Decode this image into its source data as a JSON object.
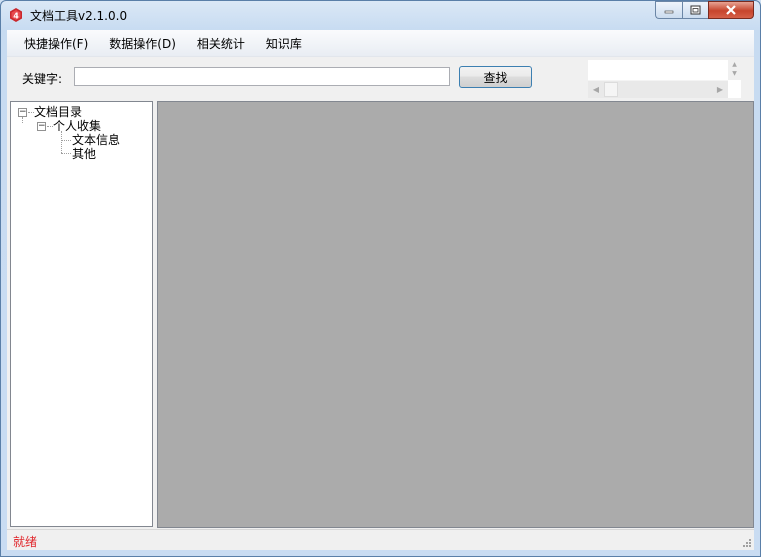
{
  "window": {
    "title": "文档工具v2.1.0.0",
    "app_icon": "app-logo-icon",
    "buttons": [
      "minimize-icon",
      "maximize-icon",
      "close-icon"
    ]
  },
  "menu": {
    "items": [
      {
        "label": "快捷操作(F)"
      },
      {
        "label": "数据操作(D)"
      },
      {
        "label": "相关统计"
      },
      {
        "label": "知识库"
      }
    ]
  },
  "search": {
    "label": "关键字:",
    "value": "",
    "button_label": "查找"
  },
  "tree": {
    "root": {
      "label": "文档目录",
      "expanded": true
    },
    "group": {
      "label": "个人收集",
      "expanded": true
    },
    "children": [
      {
        "label": "文本信息"
      },
      {
        "label": "其他"
      }
    ]
  },
  "status": {
    "text": "就绪",
    "color": "#e0262b"
  },
  "colors": {
    "content_bg": "#ababab",
    "close_button": "#c6442c"
  }
}
